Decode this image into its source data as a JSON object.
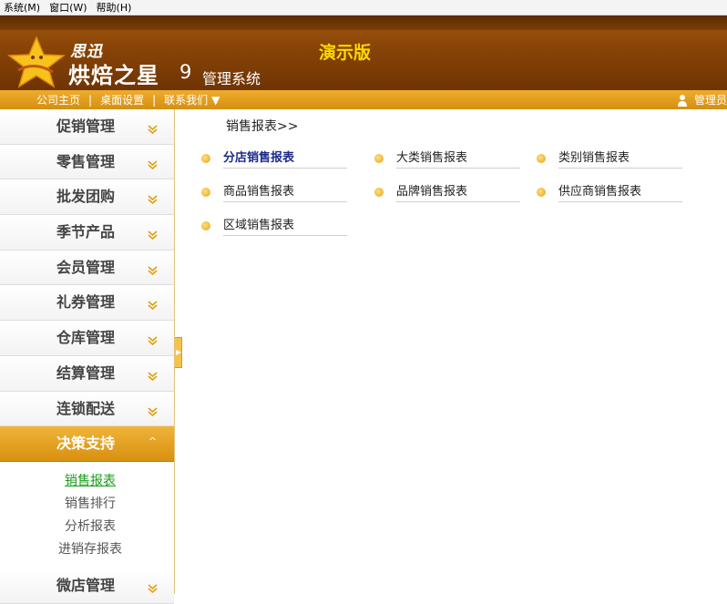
{
  "menubar": {
    "items": [
      "系统(M)",
      "窗口(W)",
      "帮助(H)"
    ]
  },
  "banner": {
    "brand_small": "思迅",
    "brand_big": "烘焙之星",
    "brand_num": "9",
    "brand_sub": "管理系统",
    "demo": "演示版",
    "colors": {
      "accent": "#ffd800",
      "bg": "#8a4507"
    }
  },
  "navbar": {
    "links": [
      "公司主页",
      "桌面设置",
      "联系我们"
    ],
    "admin": "管理员"
  },
  "sidebar": {
    "items": [
      "促销管理",
      "零售管理",
      "批发团购",
      "季节产品",
      "会员管理",
      "礼券管理",
      "仓库管理",
      "结算管理",
      "连锁配送"
    ],
    "active": "决策支持",
    "sub_items": [
      "销售报表",
      "销售排行",
      "分析报表",
      "进销存报表"
    ],
    "after_item": "微店管理"
  },
  "content": {
    "crumb": "销售报表>>",
    "reports": [
      "分店销售报表",
      "大类销售报表",
      "类别销售报表",
      "商品销售报表",
      "品牌销售报表",
      "供应商销售报表",
      "区域销售报表"
    ]
  }
}
